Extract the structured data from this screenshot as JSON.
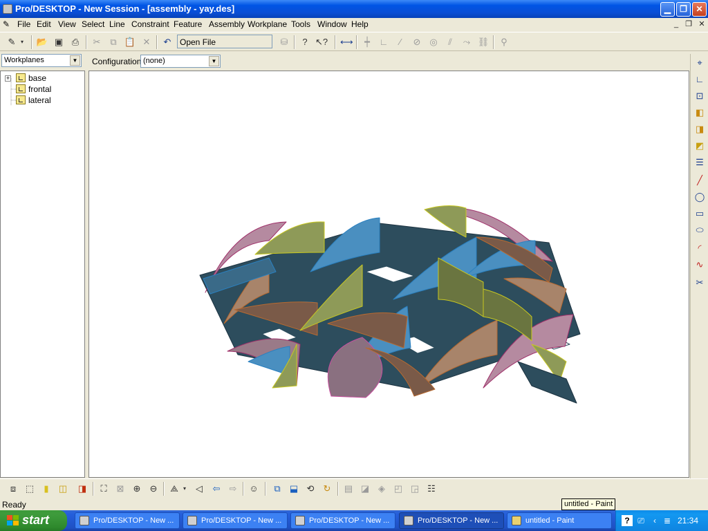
{
  "window": {
    "title": "Pro/DESKTOP - New Session - [assembly - yay.des]"
  },
  "menu": [
    "File",
    "Edit",
    "View",
    "Select",
    "Line",
    "Constraint",
    "Feature",
    "Assembly",
    "Workplane",
    "Tools",
    "Window",
    "Help"
  ],
  "toolbar": {
    "open_file": "Open File"
  },
  "bar2": {
    "browser_mode": "Workplanes",
    "config_label": "Configuration:",
    "config_value": "(none)"
  },
  "tree": {
    "items": [
      "base",
      "frontal",
      "lateral"
    ]
  },
  "status": {
    "text": "Ready",
    "tooltip": "untitled - Paint"
  },
  "taskbar": {
    "start": "start",
    "tasks": [
      "Pro/DESKTOP - New ...",
      "Pro/DESKTOP - New ...",
      "Pro/DESKTOP - New ...",
      "Pro/DESKTOP - New ...",
      "untitled - Paint"
    ],
    "clock": "21:34"
  },
  "colors": {
    "viewport_bg": "#ffffff",
    "panel_blue": "#3f8fc0",
    "panel_dark": "#2a4a5a",
    "panel_brown": "#a0705a",
    "panel_olive": "#8e9a58",
    "panel_pink": "#b08aa0"
  }
}
